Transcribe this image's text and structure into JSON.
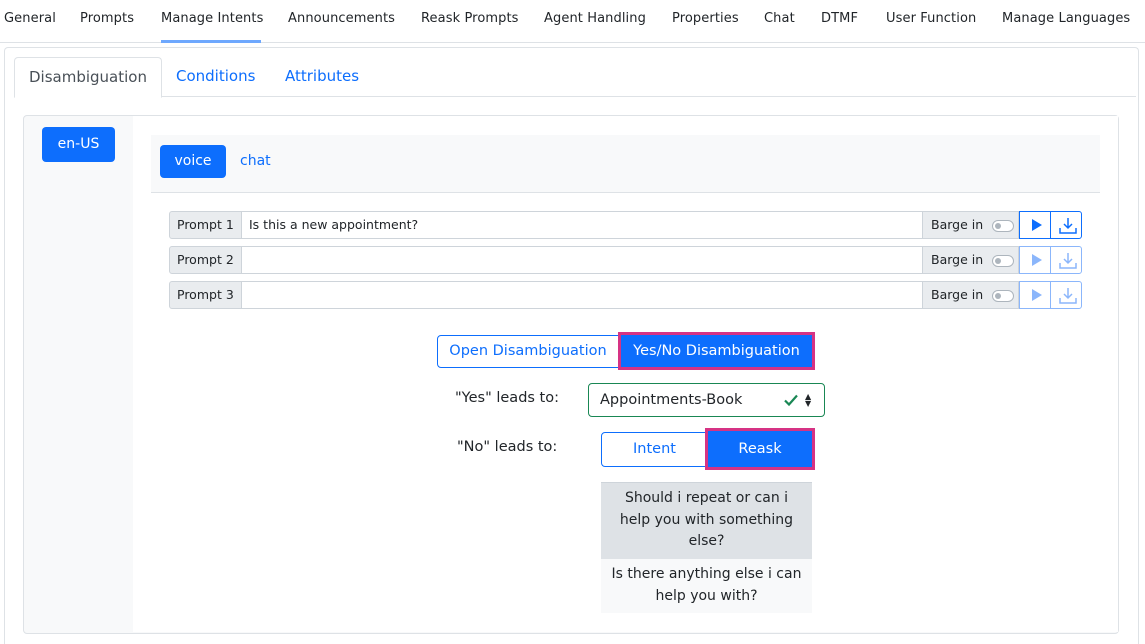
{
  "top_tabs": [
    "General",
    "Prompts",
    "Manage Intents",
    "Announcements",
    "Reask Prompts",
    "Agent Handling",
    "Properties",
    "Chat",
    "DTMF",
    "User Function",
    "Manage Languages"
  ],
  "top_tabs_active": "Manage Intents",
  "sub_tabs": [
    "Disambiguation",
    "Conditions",
    "Attributes"
  ],
  "sub_tabs_active": "Disambiguation",
  "language": "en-US",
  "channels": [
    "voice",
    "chat"
  ],
  "channel_active": "voice",
  "prompts": [
    {
      "label": "Prompt 1",
      "value": "Is this a new appointment?",
      "barge_label": "Barge in",
      "barge_in": false
    },
    {
      "label": "Prompt 2",
      "value": "",
      "barge_label": "Barge in",
      "barge_in": false
    },
    {
      "label": "Prompt 3",
      "value": "",
      "barge_label": "Barge in",
      "barge_in": false
    }
  ],
  "disambiguation_modes": [
    "Open Disambiguation",
    "Yes/No Disambiguation"
  ],
  "disambiguation_mode_active": "Yes/No Disambiguation",
  "yes_leads_to": {
    "label": "\"Yes\" leads to:",
    "value": "Appointments-Book"
  },
  "no_leads_to": {
    "label": "\"No\" leads to:",
    "options": [
      "Intent",
      "Reask"
    ],
    "active": "Reask"
  },
  "reask_options": [
    "Should i repeat or can i help you with something else?",
    "Is there anything else i can help you with?"
  ],
  "reask_selected": "Should i repeat or can i help you with something else?",
  "colors": {
    "primary": "#0d6efd",
    "highlight": "#d63384",
    "valid": "#198754"
  }
}
